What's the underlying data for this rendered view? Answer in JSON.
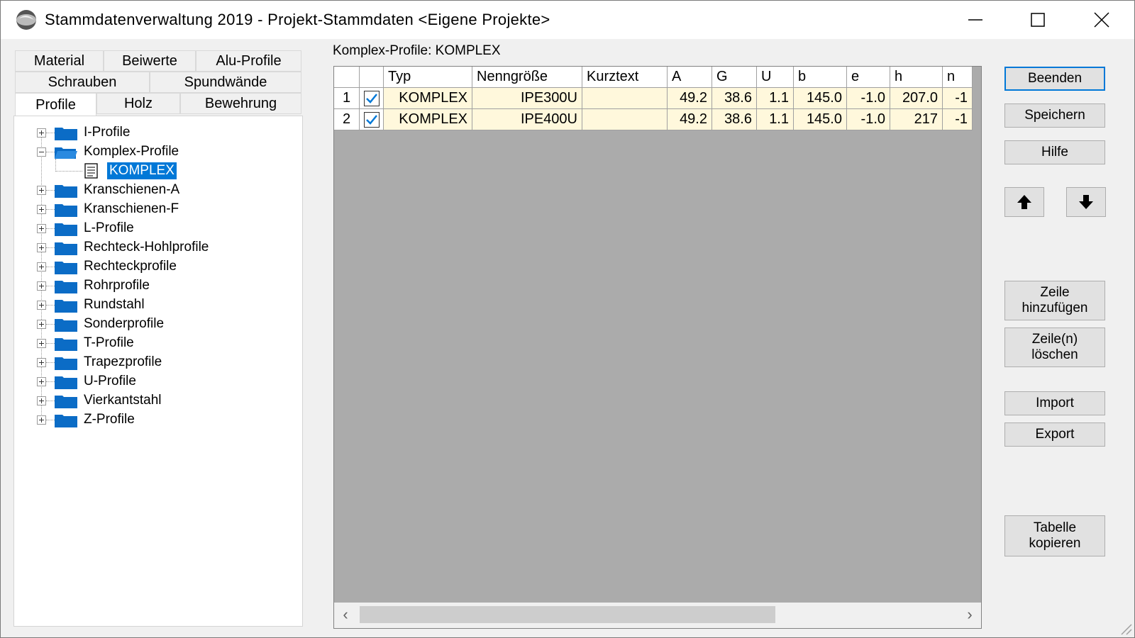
{
  "window": {
    "title": "Stammdatenverwaltung 2019 - Projekt-Stammdaten <Eigene Projekte>",
    "controls": [
      "minimize",
      "maximize",
      "close"
    ]
  },
  "tabs": {
    "row1": [
      "Material",
      "Beiwerte",
      "Alu-Profile"
    ],
    "row2": [
      "Schrauben",
      "Spundwände"
    ],
    "row3": [
      "Profile",
      "Holz",
      "Bewehrung"
    ],
    "active": "Profile"
  },
  "tree": {
    "items": [
      {
        "label": "I-Profile",
        "expanded": false
      },
      {
        "label": "Komplex-Profile",
        "expanded": true
      },
      {
        "label": "KOMPLEX",
        "child": true,
        "selected": true
      },
      {
        "label": "Kranschienen-A",
        "expanded": false
      },
      {
        "label": "Kranschienen-F",
        "expanded": false
      },
      {
        "label": "L-Profile",
        "expanded": false
      },
      {
        "label": "Rechteck-Hohlprofile",
        "expanded": false
      },
      {
        "label": "Rechteckprofile",
        "expanded": false
      },
      {
        "label": "Rohrprofile",
        "expanded": false
      },
      {
        "label": "Rundstahl",
        "expanded": false
      },
      {
        "label": "Sonderprofile",
        "expanded": false
      },
      {
        "label": "T-Profile",
        "expanded": false
      },
      {
        "label": "Trapezprofile",
        "expanded": false
      },
      {
        "label": "U-Profile",
        "expanded": false
      },
      {
        "label": "Vierkantstahl",
        "expanded": false
      },
      {
        "label": "Z-Profile",
        "expanded": false
      }
    ]
  },
  "grid": {
    "title": "Komplex-Profile: KOMPLEX",
    "columns": [
      "",
      "",
      "Typ",
      "Nenngröße",
      "Kurztext",
      "A",
      "G",
      "U",
      "b",
      "e",
      "h",
      "n"
    ],
    "rows": [
      {
        "num": "1",
        "checked": true,
        "cells": [
          "KOMPLEX",
          "IPE300U",
          "",
          "49.2",
          "38.6",
          "1.1",
          "145.0",
          "-1.0",
          "207.0",
          "-1"
        ]
      },
      {
        "num": "2",
        "checked": true,
        "cells": [
          "KOMPLEX",
          "IPE400U",
          "",
          "49.2",
          "38.6",
          "1.1",
          "145.0",
          "-1.0",
          "217",
          "-1"
        ]
      }
    ]
  },
  "buttons": {
    "beenden": "Beenden",
    "speichern": "Speichern",
    "hilfe": "Hilfe",
    "up": "arrow-up-icon",
    "down": "arrow-down-icon",
    "zeile_add": "Zeile\nhinzufügen",
    "zeile_del": "Zeile(n)\nlöschen",
    "import": "Import",
    "export": "Export",
    "tabelle_copy": "Tabelle\nkopieren"
  },
  "colors": {
    "selection": "#0078d7",
    "folder": "#0b6cc6",
    "cell_bg": "#fff8dc",
    "grid_bg": "#ababab",
    "default_button_border": "#0078d7"
  }
}
